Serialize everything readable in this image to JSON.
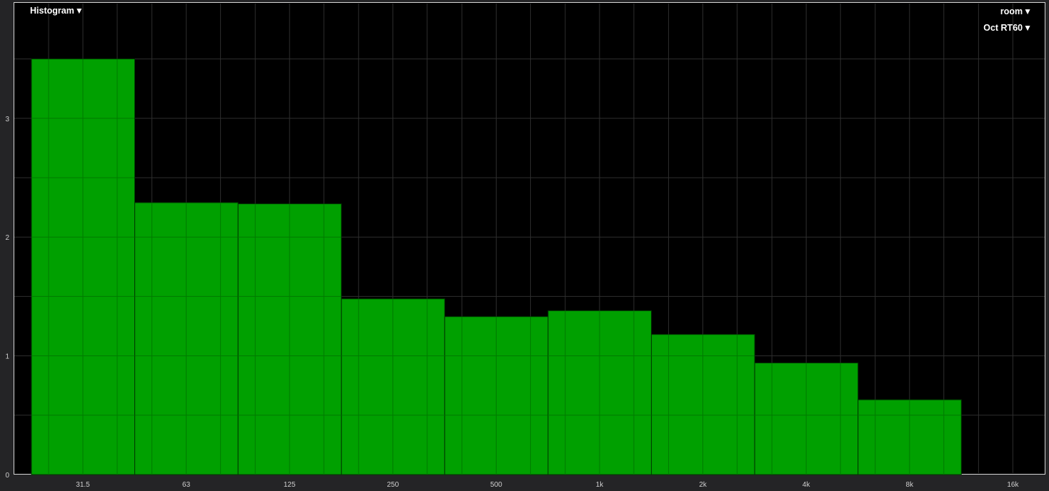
{
  "controls": {
    "view_label": "Histogram",
    "source_label": "room",
    "metric_label": "Oct RT60",
    "caret": "▼"
  },
  "colors": {
    "bar_fill": "#00a000",
    "background": "#000000",
    "grid": "#2e2e2e",
    "frame": "#d6d6d6"
  },
  "chart_data": {
    "type": "bar",
    "title": "",
    "xlabel": "",
    "ylabel": "",
    "x_scale": "log2",
    "categories": [
      "31.5",
      "63",
      "125",
      "250",
      "500",
      "1k",
      "2k",
      "4k",
      "8k",
      "16k"
    ],
    "values": [
      3.5,
      2.29,
      2.28,
      1.48,
      1.33,
      1.38,
      1.18,
      0.94,
      0.63,
      null
    ],
    "y_ticks": [
      "0",
      "1",
      "2",
      "3"
    ],
    "ylim": [
      0,
      3.98
    ],
    "grid": true
  }
}
